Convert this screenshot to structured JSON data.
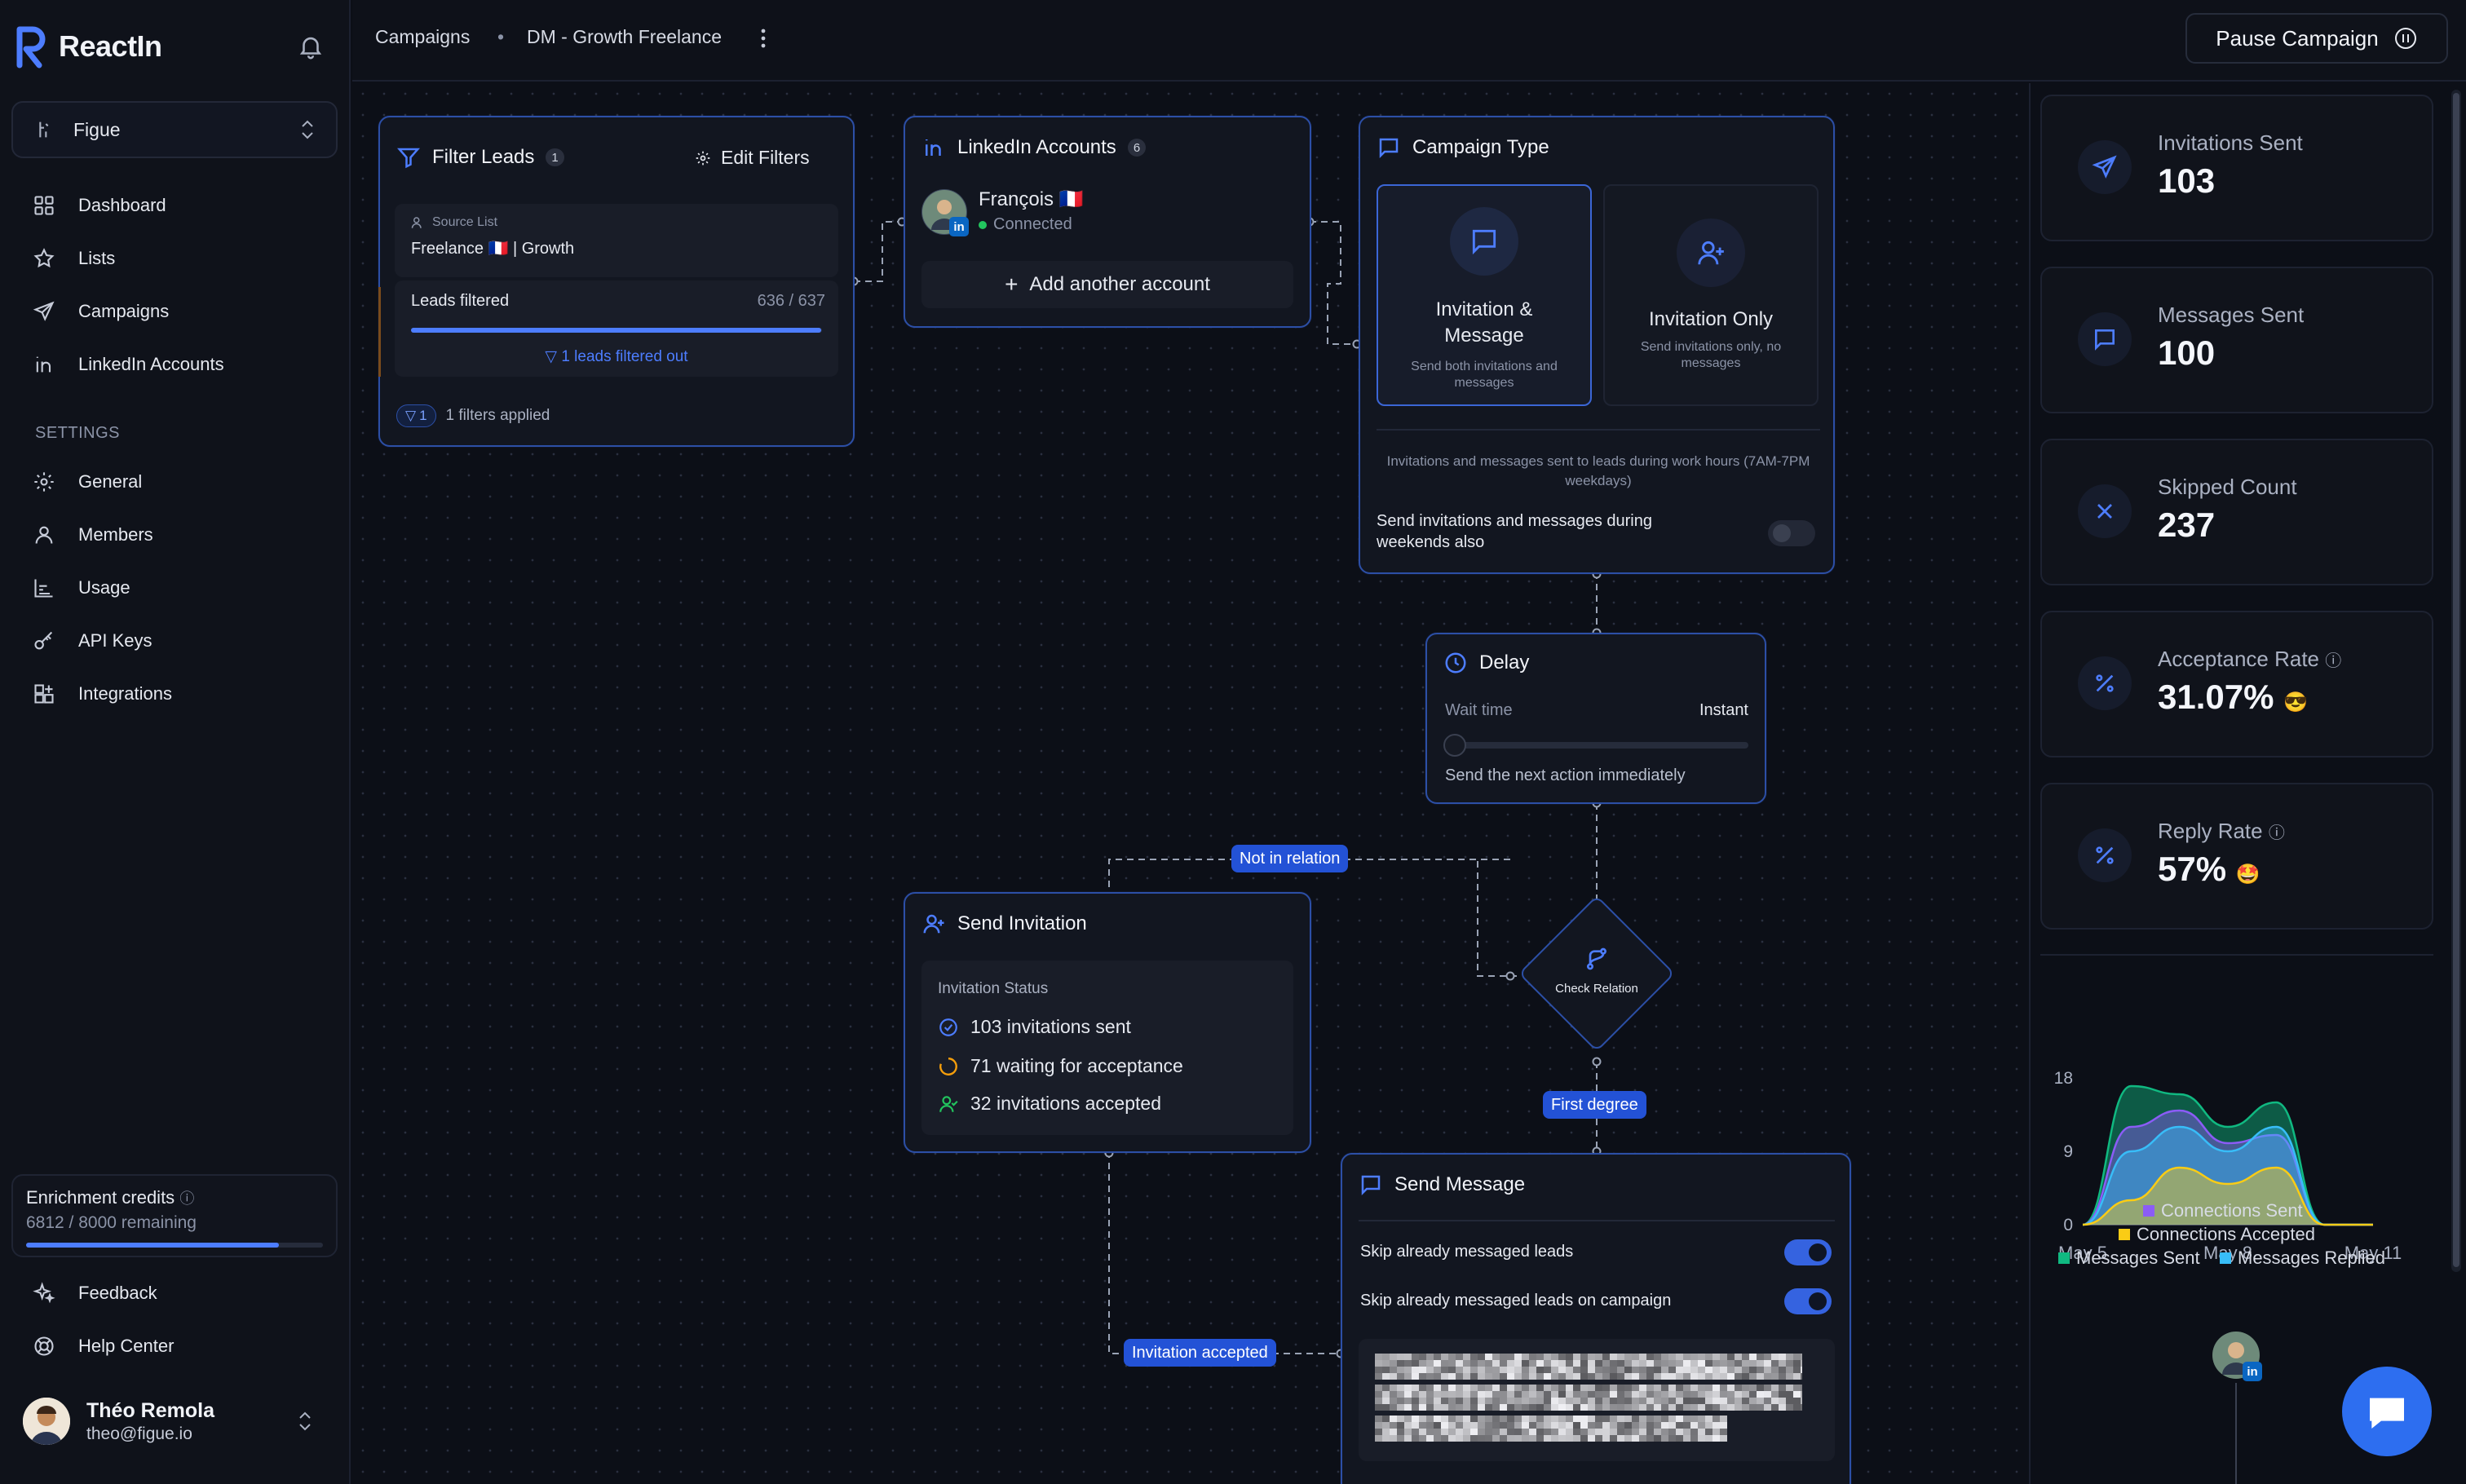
{
  "app": {
    "name": "ReactIn"
  },
  "workspace": {
    "name": "Figue"
  },
  "nav": {
    "dashboard": "Dashboard",
    "lists": "Lists",
    "campaigns": "Campaigns",
    "linkedin_accounts": "LinkedIn Accounts"
  },
  "settings": {
    "heading": "SETTINGS",
    "general": "General",
    "members": "Members",
    "usage": "Usage",
    "api_keys": "API Keys",
    "integrations": "Integrations"
  },
  "credits": {
    "title": "Enrichment credits",
    "remaining": "6812 / 8000 remaining",
    "fraction": 0.8515
  },
  "bottom_nav": {
    "feedback": "Feedback",
    "help": "Help Center"
  },
  "user": {
    "name": "Théo Remola",
    "email": "theo@figue.io"
  },
  "breadcrumb": {
    "root": "Campaigns",
    "separator": "•",
    "current": "DM - Growth Freelance"
  },
  "header": {
    "pause_label": "Pause Campaign"
  },
  "filter_node": {
    "title": "Filter Leads",
    "count": "1",
    "edit_label": "Edit Filters",
    "source_label": "Source List",
    "source_value": "Freelance 🇫🇷 | Growth",
    "leads_label": "Leads filtered",
    "leads_value": "636",
    "leads_total": "/ 637",
    "leads_fraction": 0.998,
    "filtered_out": "1 leads filtered out",
    "filters_badge": "1",
    "filters_applied": "1 filters applied"
  },
  "accounts_node": {
    "title": "LinkedIn Accounts",
    "count": "6",
    "account_name": "François 🇫🇷",
    "account_status": "Connected",
    "add_label": "Add another account"
  },
  "campaign_type_node": {
    "title": "Campaign Type",
    "option1_title": "Invitation & Message",
    "option1_desc": "Send both invitations and messages",
    "option2_title": "Invitation Only",
    "option2_desc": "Send invitations only, no messages",
    "hours_note": "Invitations and messages sent to leads during work hours (7AM-7PM weekdays)",
    "weekend_label": "Send invitations and messages during weekends also"
  },
  "delay_node": {
    "title": "Delay",
    "wait_label": "Wait time",
    "wait_value": "Instant",
    "note": "Send the next action immediately"
  },
  "edges": {
    "not_in_relation": "Not in relation",
    "first_degree": "First degree",
    "invitation_accepted": "Invitation accepted"
  },
  "check_node": {
    "title": "Check Relation"
  },
  "invite_node": {
    "title": "Send Invitation",
    "status_label": "Invitation Status",
    "sent": "103 invitations sent",
    "waiting": "71 waiting for acceptance",
    "accepted": "32 invitations accepted"
  },
  "message_node": {
    "title": "Send Message",
    "skip1": "Skip already messaged leads",
    "skip2": "Skip already messaged leads on campaign"
  },
  "stats": [
    {
      "label": "Invitations Sent",
      "value": "103",
      "icon": "send-icon"
    },
    {
      "label": "Messages Sent",
      "value": "100",
      "icon": "message-icon"
    },
    {
      "label": "Skipped Count",
      "value": "237",
      "icon": "x-icon"
    },
    {
      "label": "Acceptance Rate",
      "value": "31.07%",
      "icon": "percent-icon",
      "emoji": "😎"
    },
    {
      "label": "Reply Rate",
      "value": "57%",
      "icon": "percent-icon",
      "emoji": "🤩"
    }
  ],
  "colors": {
    "accent": "#4d7dff",
    "connected": "#22c55e",
    "purple": "#8b5cf6",
    "yellow": "#facc15",
    "green": "#10b981",
    "cyan": "#38bdf8"
  },
  "chart_data": {
    "type": "area",
    "categories": [
      "May 5",
      "May 6",
      "May 7",
      "May 8",
      "May 9",
      "May 10",
      "May 11"
    ],
    "x_tick_labels": [
      "May 5",
      "May 8",
      "May 11"
    ],
    "y_ticks": [
      "0",
      "9",
      "18"
    ],
    "ylim": [
      0,
      18
    ],
    "grid": false,
    "legend_position": "bottom",
    "series": [
      {
        "name": "Connections Sent",
        "color": "#8b5cf6",
        "values": [
          0,
          12,
          14,
          10,
          11,
          0,
          0
        ]
      },
      {
        "name": "Connections Accepted",
        "color": "#facc15",
        "values": [
          0,
          3,
          7,
          5,
          7,
          0,
          0
        ]
      },
      {
        "name": "Messages Sent",
        "color": "#10b981",
        "values": [
          0,
          17,
          16,
          12,
          15,
          0,
          0
        ]
      },
      {
        "name": "Messages Replied",
        "color": "#38bdf8",
        "values": [
          0,
          9,
          12,
          9,
          12,
          0,
          0
        ]
      }
    ]
  }
}
